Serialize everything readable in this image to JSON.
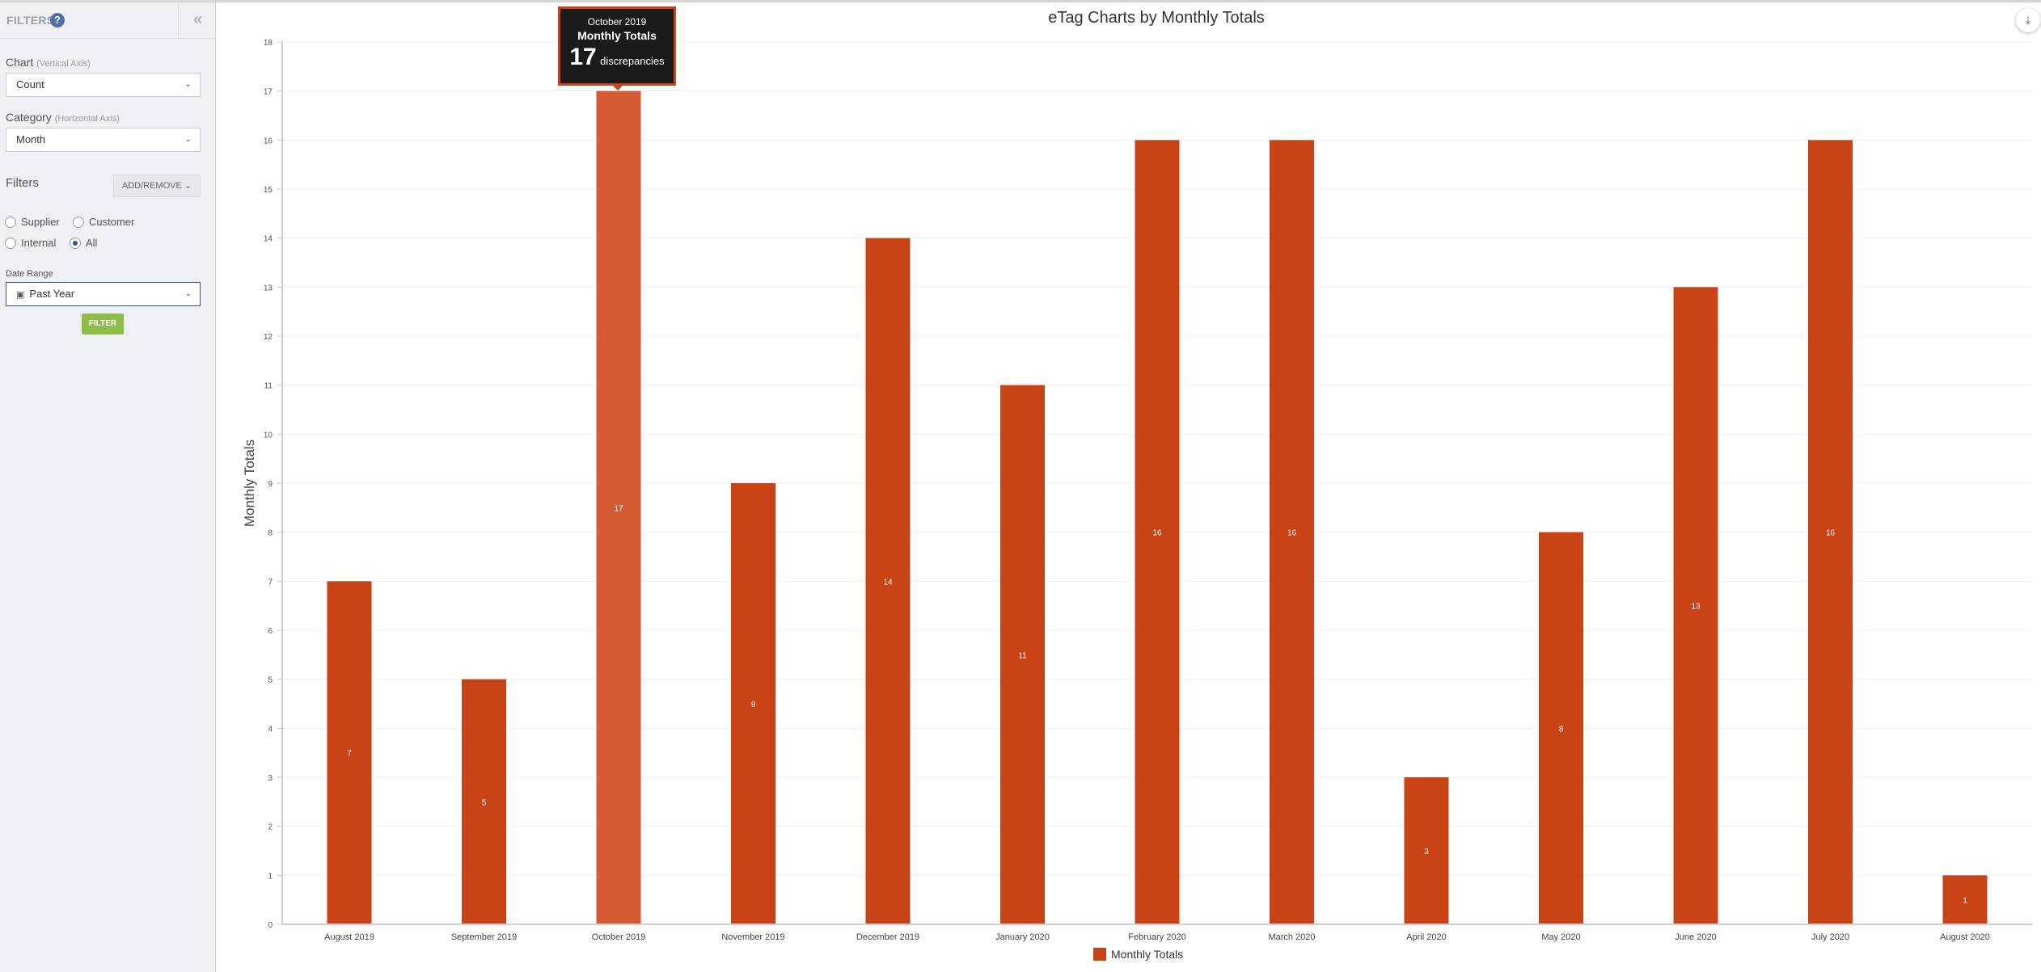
{
  "sidebar": {
    "title": "FILTERS",
    "help_icon": "?",
    "collapse_icon": "«",
    "chart_label": "Chart",
    "chart_sub": "(Vertical Axis)",
    "chart_value": "Count",
    "category_label": "Category",
    "category_sub": "(Horizontal Axis)",
    "category_value": "Month",
    "filters_label": "Filters",
    "add_remove_label": "ADD/REMOVE",
    "radios": [
      {
        "label": "Supplier",
        "selected": false
      },
      {
        "label": "Customer",
        "selected": false
      },
      {
        "label": "Internal",
        "selected": false
      },
      {
        "label": "All",
        "selected": true
      }
    ],
    "date_range_label": "Date Range",
    "date_range_value": "Past Year",
    "filter_button": "FILTER"
  },
  "download_icon": "⤓",
  "tooltip": {
    "month": "October 2019",
    "series": "Monthly Totals",
    "value": "17",
    "unit": "discrepancies"
  },
  "colors": {
    "bar": "#c84315",
    "bar_hover": "#d35c35",
    "accent": "#3e4f8a",
    "filter_button": "#8fbd4a"
  },
  "chart_data": {
    "type": "bar",
    "title": "eTag Charts by Monthly Totals",
    "xlabel": "",
    "ylabel": "Monthly Totals",
    "ylim": [
      0,
      18
    ],
    "yticks": [
      0,
      1,
      2,
      3,
      4,
      5,
      6,
      7,
      8,
      9,
      10,
      11,
      12,
      13,
      14,
      15,
      16,
      17,
      18
    ],
    "grid": true,
    "legend": "bottom-center",
    "categories": [
      "August 2019",
      "September 2019",
      "October 2019",
      "November 2019",
      "December 2019",
      "January 2020",
      "February 2020",
      "March 2020",
      "April 2020",
      "May 2020",
      "June 2020",
      "July 2020",
      "August 2020"
    ],
    "series": [
      {
        "name": "Monthly Totals",
        "values": [
          7,
          5,
          17,
          9,
          14,
          11,
          16,
          16,
          3,
          8,
          13,
          16,
          1
        ]
      }
    ],
    "highlighted_category": "October 2019"
  }
}
